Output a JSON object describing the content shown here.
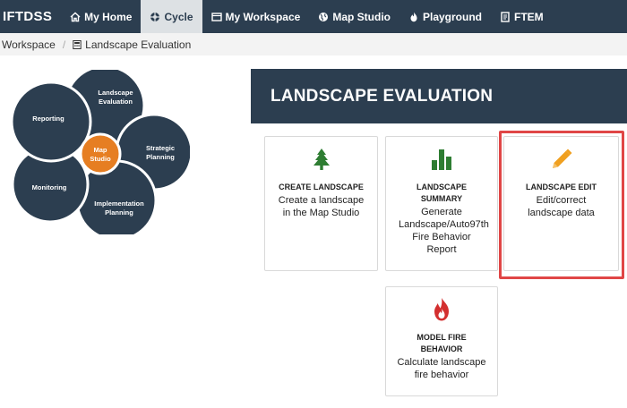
{
  "nav": {
    "brand": "IFTDSS",
    "items": [
      {
        "label": "My Home",
        "icon": "home-icon"
      },
      {
        "label": "Cycle",
        "icon": "cycle-icon"
      },
      {
        "label": "My Workspace",
        "icon": "workspace-icon"
      },
      {
        "label": "Map Studio",
        "icon": "globe-icon"
      },
      {
        "label": "Playground",
        "icon": "fire-icon"
      },
      {
        "label": "FTEM",
        "icon": "document-icon"
      }
    ],
    "active": "Cycle",
    "color": "#2c3e50"
  },
  "breadcrumb": {
    "root": "Workspace",
    "current": "Landscape Evaluation"
  },
  "cycle": {
    "center": [
      "Map",
      "Studio"
    ],
    "segments": [
      {
        "lines": [
          "Landscape",
          "Evaluation"
        ]
      },
      {
        "lines": [
          "Strategic",
          "Planning"
        ]
      },
      {
        "lines": [
          "Implementation",
          "Planning"
        ]
      },
      {
        "lines": [
          "Monitoring"
        ]
      },
      {
        "lines": [
          "Reporting"
        ]
      }
    ],
    "colors": {
      "dark": "#2c3e50",
      "center": "#e67e22"
    }
  },
  "banner": {
    "title": "LANDSCAPE EVALUATION"
  },
  "cards": {
    "create": {
      "title": "CREATE LANDSCAPE",
      "desc": "Create a landscape in the Map Studio",
      "icon": "tree-icon",
      "color": "#2e7d32"
    },
    "summary": {
      "title": "LANDSCAPE SUMMARY",
      "desc": "Generate Landscape/Auto97th Fire Behavior Report",
      "icon": "bar-chart-icon",
      "color": "#2e7d32"
    },
    "edit": {
      "title": "LANDSCAPE EDIT",
      "desc": "Edit/correct landscape data",
      "icon": "pencil-icon",
      "color": "#f0a020"
    },
    "model": {
      "title": "MODEL FIRE BEHAVIOR",
      "desc": "Calculate landscape fire behavior",
      "icon": "fire-icon",
      "color": "#d32f2f"
    }
  },
  "highlight_color": "#e04646"
}
